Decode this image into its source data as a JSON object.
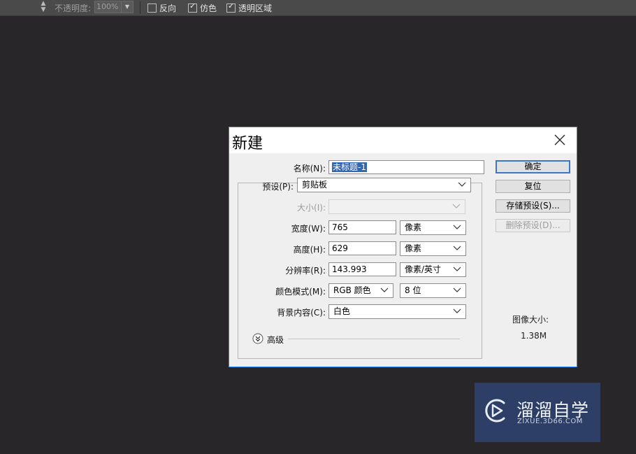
{
  "options_bar": {
    "opacity_label": "不透明度:",
    "opacity_value": "100%",
    "checkboxes": [
      {
        "label": "反向",
        "checked": false
      },
      {
        "label": "仿色",
        "checked": true
      },
      {
        "label": "透明区域",
        "checked": true
      }
    ]
  },
  "dialog": {
    "title": "新建",
    "name_label": "名称(N):",
    "name_value": "未标题-1",
    "preset_label": "预设(P):",
    "preset_value": "剪贴板",
    "size_label": "大小(I):",
    "size_value": "",
    "width_label": "宽度(W):",
    "width_value": "765",
    "width_unit": "像素",
    "height_label": "高度(H):",
    "height_value": "629",
    "height_unit": "像素",
    "resolution_label": "分辨率(R):",
    "resolution_value": "143.993",
    "resolution_unit": "像素/英寸",
    "color_mode_label": "颜色模式(M):",
    "color_mode_value": "RGB 颜色",
    "bit_depth_value": "8 位",
    "background_label": "背景内容(C):",
    "background_value": "白色",
    "advanced_label": "高级",
    "buttons": {
      "ok": "确定",
      "reset": "复位",
      "save_preset": "存储预设(S)...",
      "delete_preset": "删除预设(D)..."
    },
    "image_size_label": "图像大小:",
    "image_size_value": "1.38M"
  },
  "watermark": {
    "name_cn": "溜溜自学",
    "name_en": "ZIXUE.3D66.COM"
  },
  "colors": {
    "canvas_bg": "#282628",
    "dialog_border": "#1e90ff",
    "selection": "#3267b5",
    "watermark_bg": "#2d3e67"
  }
}
